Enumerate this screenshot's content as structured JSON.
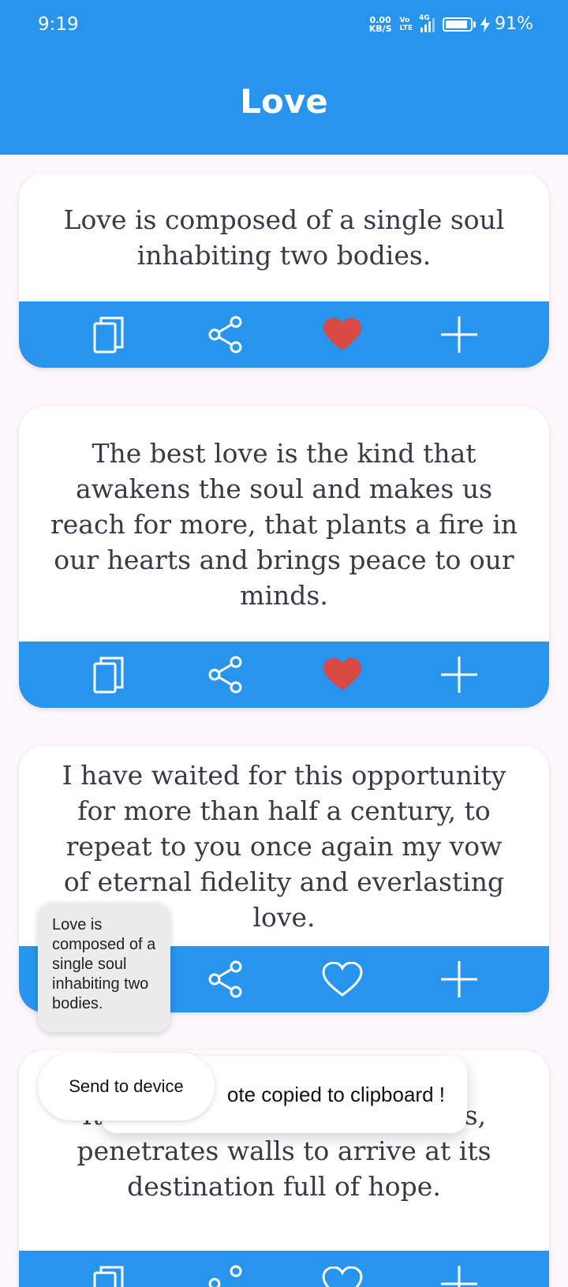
{
  "status_bar": {
    "time": "9:19",
    "net_speed_value": "0.00",
    "net_speed_unit": "KB/S",
    "volte_top": "Vo",
    "volte_bottom": "LTE",
    "network": "4G",
    "battery_percent": "91%",
    "battery_level": 0.91
  },
  "app_bar": {
    "title": "Love"
  },
  "quotes": [
    {
      "text": "Love is composed of a single soul inhabiting two bodies.",
      "favorited": true
    },
    {
      "text": "The best love is the kind that awakens the soul and makes us reach for more, that plants a fire in our hearts and brings peace to our minds.",
      "favorited": true
    },
    {
      "text": "I have waited for this opportunity for more than half a century, to repeat to you once again my vow of eternal fidelity and everlasting love.",
      "favorited": false
    },
    {
      "text": "It jumps hurdles, leaps fences, penetrates walls to arrive at its destination full of hope.",
      "favorited": false
    }
  ],
  "popup_quote": "Love is composed of a single soul inhabiting two bodies.",
  "toast": "Quote copied to clipboard !",
  "toast_visible": "ote copied to clipboard !",
  "send_to_device": "Send to device",
  "icons": {
    "copy": "copy-icon",
    "share": "share-icon",
    "favorite": "heart-icon",
    "add": "plus-icon"
  },
  "colors": {
    "primary": "#2795ee",
    "heart_filled": "#d94a45",
    "background": "#fdf7fb",
    "text": "#3a3a46"
  }
}
